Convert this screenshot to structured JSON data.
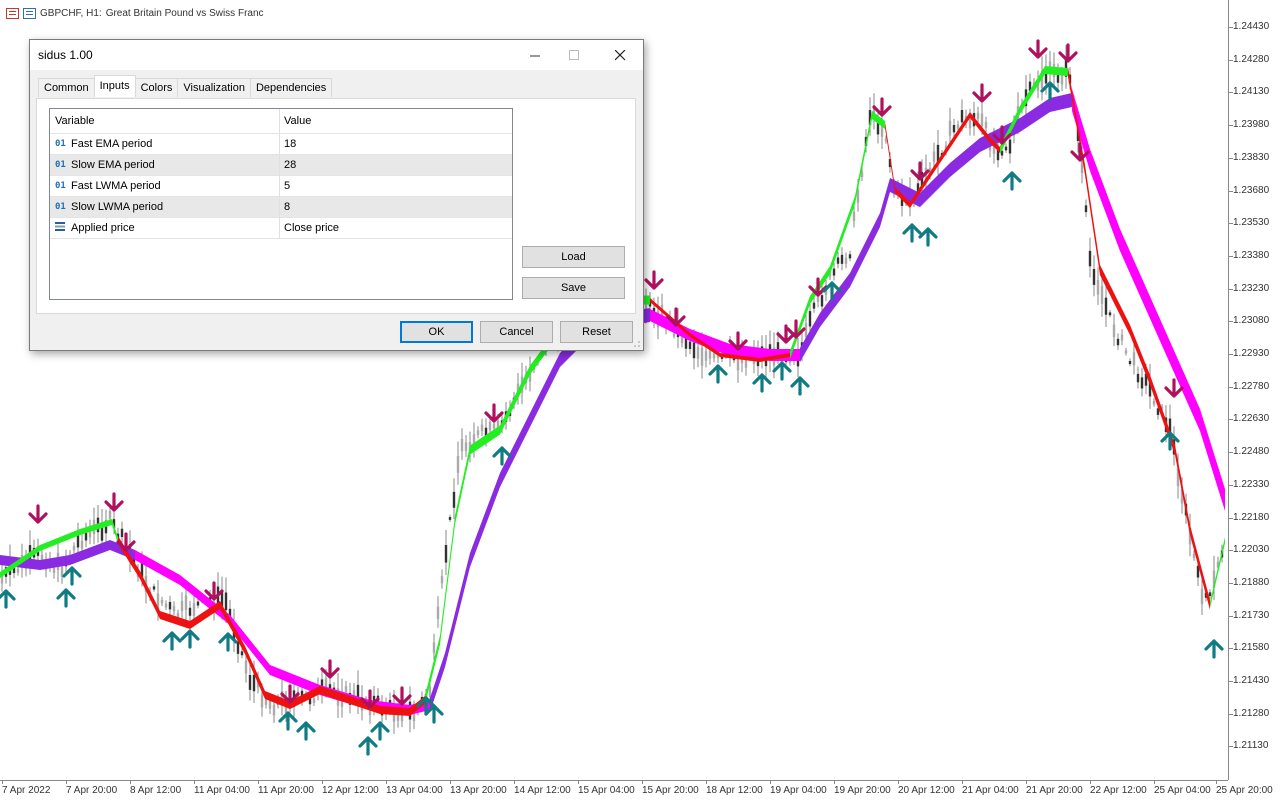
{
  "chart": {
    "header": {
      "symbol": "GBPCHF, H1:",
      "description": "Great Britain Pound vs Swiss Franc"
    },
    "price_labels": [
      "1.24430",
      "1.24280",
      "1.24130",
      "1.23980",
      "1.23830",
      "1.23680",
      "1.23530",
      "1.23380",
      "1.23230",
      "1.23080",
      "1.22930",
      "1.22780",
      "1.22630",
      "1.22480",
      "1.22330",
      "1.22180",
      "1.22030",
      "1.21880",
      "1.21730",
      "1.21580",
      "1.21430",
      "1.21280",
      "1.21130"
    ],
    "time_labels": [
      "7 Apr 2022",
      "7 Apr 20:00",
      "8 Apr 12:00",
      "11 Apr 04:00",
      "11 Apr 20:00",
      "12 Apr 12:00",
      "13 Apr 04:00",
      "13 Apr 20:00",
      "14 Apr 12:00",
      "15 Apr 04:00",
      "15 Apr 20:00",
      "18 Apr 12:00",
      "19 Apr 04:00",
      "19 Apr 20:00",
      "20 Apr 12:00",
      "21 Apr 04:00",
      "21 Apr 20:00",
      "22 Apr 12:00",
      "25 Apr 04:00",
      "25 Apr 20:00"
    ],
    "colors": {
      "fast_up": "#22ee22",
      "fast_down": "#ee1111",
      "slow_up": "#8a2be2",
      "slow_down": "#ff00ff",
      "arrow_up": "#0f7b82",
      "arrow_down": "#b0105e",
      "candles": "#8a8a8a"
    },
    "icons": {
      "arrow_up": "arrow-up-icon",
      "arrow_down": "arrow-down-icon"
    }
  },
  "dialog": {
    "title": "sidus 1.00",
    "tabs": [
      "Common",
      "Inputs",
      "Colors",
      "Visualization",
      "Dependencies"
    ],
    "active_tab": "Inputs",
    "columns": {
      "variable": "Variable",
      "value": "Value"
    },
    "rows": [
      {
        "icon": "01",
        "variable": "Fast EMA period",
        "value": "18"
      },
      {
        "icon": "01",
        "variable": "Slow EMA period",
        "value": "28"
      },
      {
        "icon": "01",
        "variable": "Fast LWMA period",
        "value": "5"
      },
      {
        "icon": "01",
        "variable": "Slow LWMA period",
        "value": "8"
      },
      {
        "icon": "list",
        "variable": "Applied price",
        "value": "Close price"
      }
    ],
    "buttons": {
      "load": "Load",
      "save": "Save",
      "ok": "OK",
      "cancel": "Cancel",
      "reset": "Reset"
    }
  }
}
